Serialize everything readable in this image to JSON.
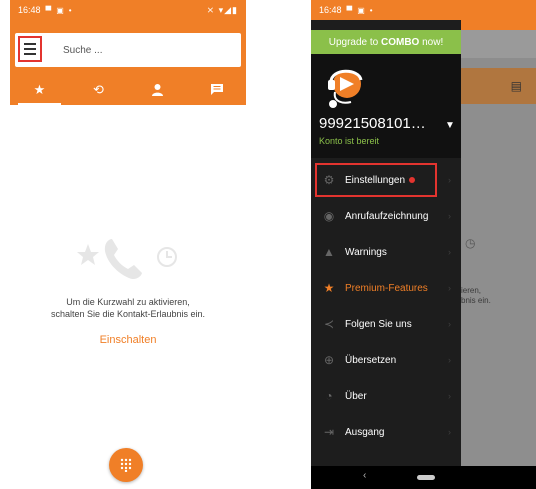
{
  "left": {
    "status": {
      "time": "16:48",
      "icons": [
        "notification-icon",
        "notification-icon",
        "dot-icon"
      ],
      "right_icons": [
        "mute-icon",
        "wifi-icon",
        "signal-icon",
        "battery-icon"
      ]
    },
    "search_placeholder": "Suche ...",
    "tabs": [
      {
        "icon": "star-icon",
        "active": true
      },
      {
        "icon": "history-icon",
        "active": false
      },
      {
        "icon": "person-icon",
        "active": false
      },
      {
        "icon": "message-icon",
        "active": false
      }
    ],
    "empty_message_line1": "Um die Kurzwahl zu aktivieren,",
    "empty_message_line2": "schalten Sie die Kontakt-Erlaubnis ein.",
    "enable_label": "Einschalten"
  },
  "right": {
    "status": {
      "time": "16:48"
    },
    "upgrade_prefix": "Upgrade to ",
    "upgrade_bold": "COMBO",
    "upgrade_suffix": " now!",
    "account_number": "99921508101…",
    "account_status": "Konto ist bereit",
    "menu": [
      {
        "label": "Einstellungen",
        "icon": "gear-icon",
        "badge": true
      },
      {
        "label": "Anrufaufzeichnung",
        "icon": "record-icon"
      },
      {
        "label": "Warnings",
        "icon": "warning-icon"
      },
      {
        "label": "Premium-Features",
        "icon": "star-icon"
      },
      {
        "label": "Folgen Sie uns",
        "icon": "share-icon"
      },
      {
        "label": "Übersetzen",
        "icon": "globe-icon"
      },
      {
        "label": "Über",
        "icon": "info-icon"
      },
      {
        "label": "Ausgang",
        "icon": "exit-icon"
      }
    ],
    "ghost_text_line1": "ieren,",
    "ghost_text_line2": "bnis ein."
  },
  "colors": {
    "accent": "#f07f27",
    "green": "#8bc04a",
    "drawer": "#1d1d1d",
    "highlight": "#e3342f"
  }
}
